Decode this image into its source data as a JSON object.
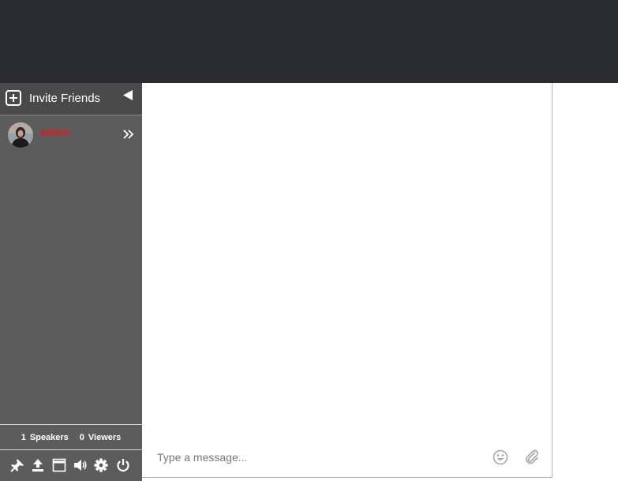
{
  "sidebar": {
    "invite_label": "Invite Friends",
    "user": {
      "name": "admin"
    },
    "stats": {
      "speakers_count": "1",
      "speakers_label": "Speakers",
      "viewers_count": "0",
      "viewers_label": "Viewers"
    },
    "toolbar": [
      {
        "icon": "pin-icon"
      },
      {
        "icon": "upload-icon"
      },
      {
        "icon": "window-icon"
      },
      {
        "icon": "volume-icon"
      },
      {
        "icon": "gear-icon"
      },
      {
        "icon": "power-icon"
      }
    ]
  },
  "chat": {
    "input_placeholder": "Type a message..."
  },
  "colors": {
    "topbar": "#2b2c30",
    "sidebar": "#5c5c5c",
    "invite_bar": "#4a4a4a",
    "username": "#e01a1a"
  }
}
